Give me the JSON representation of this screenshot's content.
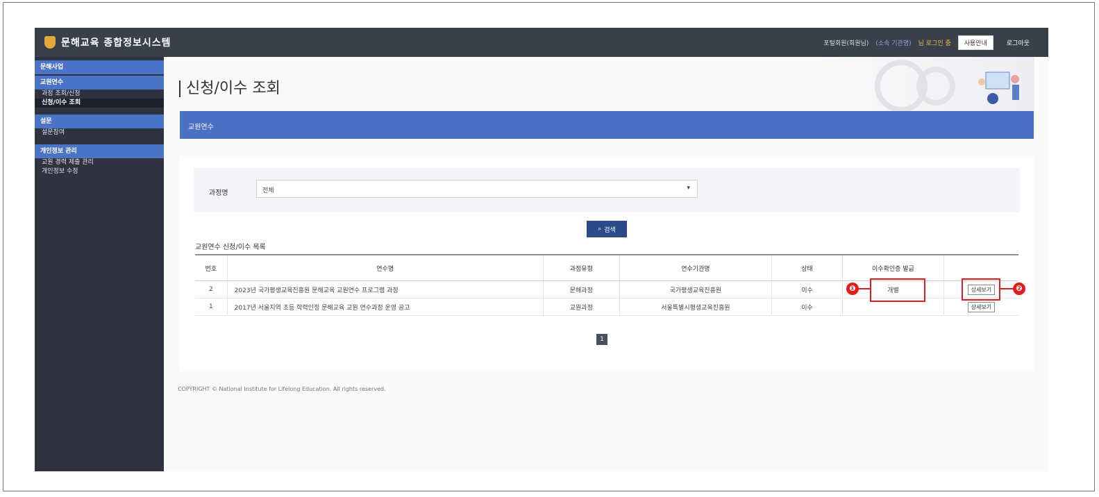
{
  "header": {
    "app_title": "문해교육 종합정보시스템",
    "user_info": "포털회원(회원님)",
    "user_info_highlight": "(소속 기관명)",
    "user_notice": "님 로그인 중",
    "btn_mypage": "사용안내",
    "btn_logout": "로그아웃"
  },
  "sidebar": {
    "groups": [
      {
        "label": "문해사업",
        "items": []
      },
      {
        "label": "교원연수",
        "items": [
          "과정 조회/신청",
          "신청/이수 조회"
        ]
      },
      {
        "label": "설문",
        "items": [
          "설문참여"
        ]
      },
      {
        "label": "개인정보 관리",
        "items": [
          "교원 경력 제출 관리",
          "개인정보 수정"
        ]
      }
    ]
  },
  "page": {
    "title": "신청/이수 조회",
    "band_label": "교원연수",
    "filter_label": "과정명",
    "filter_value": "전체",
    "search_label": "검색",
    "list_title": "교원연수 신청/이수 목록"
  },
  "table": {
    "headers": [
      "번호",
      "연수명",
      "과정유형",
      "연수기관명",
      "상태",
      "이수확인증 발급",
      ""
    ],
    "rows": [
      {
        "no": "2",
        "name": "2023년 국가평생교육진흥원 문해교육 교원연수 프로그램 과정",
        "type": "문해과정",
        "org": "국가평생교육진흥원",
        "status": "이수",
        "cert": "개별",
        "detail": "상세보기"
      },
      {
        "no": "1",
        "name": "2017년 서울지역 초등 학력인정 문해교육 교원 연수과정 운영 공고",
        "type": "교원과정",
        "org": "서울특별시평생교육진흥원",
        "status": "이수",
        "cert": "",
        "detail": "상세보기"
      }
    ]
  },
  "pager": {
    "current": "1"
  },
  "footer": {
    "copyright": "COPYRIGHT © National Institute for Lifelong Education. All rights reserved."
  },
  "annotations": {
    "one": "❶",
    "two": "❷"
  }
}
